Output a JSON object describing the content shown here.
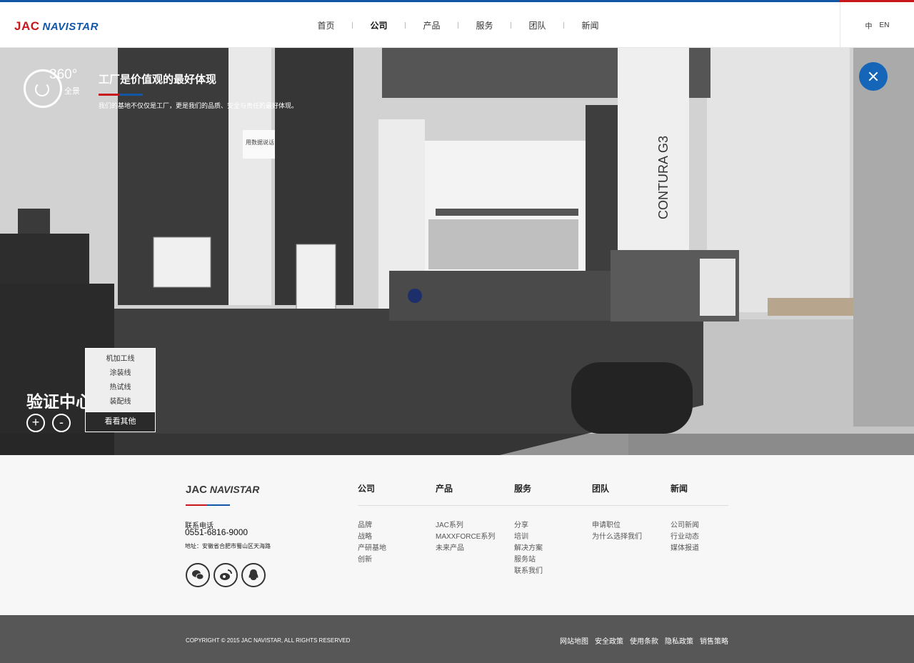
{
  "brand": {
    "jac": "JAC",
    "navistar": "NAVISTAR"
  },
  "nav": {
    "items": [
      {
        "label": "首页"
      },
      {
        "label": "公司",
        "active": true
      },
      {
        "label": "产品"
      },
      {
        "label": "服务"
      },
      {
        "label": "团队"
      },
      {
        "label": "新闻"
      }
    ],
    "lang": {
      "zh": "中",
      "en": "EN"
    }
  },
  "hero": {
    "pano_degree": "360°",
    "pano_label": "全景",
    "title": "工厂是价值观的最好体现",
    "subtitle": "我们的基地不仅仅是工厂，更是我们的品质、安全与责任的最好体现。",
    "area_name": "验证中心",
    "zoom_in": "+",
    "zoom_out": "-",
    "line_menu": [
      "机加工线",
      "涂装线",
      "热试线",
      "装配线"
    ],
    "more_label": "看看其他",
    "scene_texts": {
      "machine_brand": "CONTURA G3",
      "sign": "用数据说话"
    }
  },
  "footer": {
    "phone_label": "联系电话",
    "phone": "0551-6816-9000",
    "address": "地址：安徽省合肥市蜀山区天海路",
    "columns": [
      {
        "title": "公司",
        "links": [
          "品牌",
          "战略",
          "产研基地",
          "创新"
        ]
      },
      {
        "title": "产品",
        "links": [
          "JAC系列",
          "MAXXFORCE系列",
          "未来产品"
        ]
      },
      {
        "title": "服务",
        "links": [
          "分享",
          "培训",
          "解决方案",
          "服务站",
          "联系我们"
        ]
      },
      {
        "title": "团队",
        "links": [
          "申请职位",
          "为什么选择我们"
        ]
      },
      {
        "title": "新闻",
        "links": [
          "公司新闻",
          "行业动态",
          "媒体报道"
        ]
      }
    ],
    "social": [
      "wechat-icon",
      "weibo-icon",
      "qq-icon"
    ],
    "copyright": "COPYRIGHT © 2015 JAC NAVISTAR, ALL RIGHTS RESERVED",
    "legal": [
      "网站地图",
      "安全政策",
      "使用条款",
      "隐私政策",
      "销售策略"
    ]
  },
  "colors": {
    "brand_red": "#c8161d",
    "brand_blue": "#1256a8",
    "close_button": "#1565b8",
    "bottom_bar": "#575757"
  }
}
